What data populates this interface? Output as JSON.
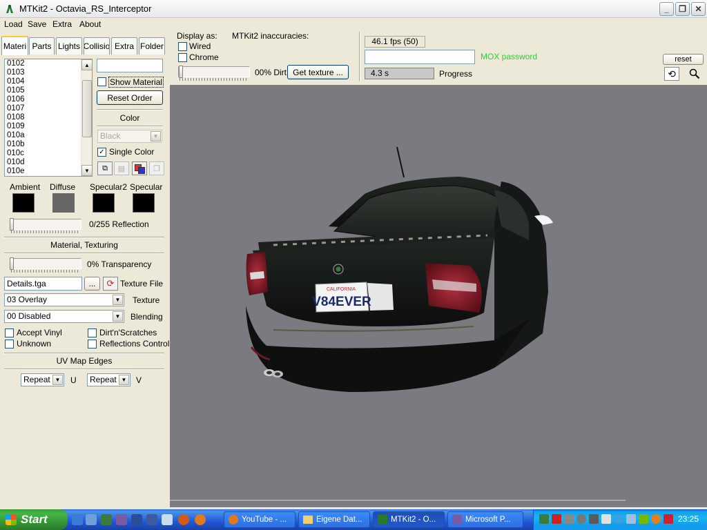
{
  "window": {
    "title": "MTKit2 - Octavia_RS_Interceptor"
  },
  "menu": [
    "Load",
    "Save",
    "Extra",
    "About"
  ],
  "display_as": {
    "label": "Display as:",
    "wired": "Wired",
    "chrome": "Chrome",
    "dirt_label": "00% Dirt",
    "get_texture": "Get texture ..."
  },
  "inaccuracies": {
    "label": "MTKit2 inaccuracies:"
  },
  "status": {
    "fps": "46.1 fps (50)",
    "mox_password": "MOX password",
    "time": "4.3 s",
    "progress_label": "Progress",
    "reset": "reset",
    "progress": 0.0
  },
  "tabs": [
    "Materi",
    "Parts",
    "Lights",
    "Collisio",
    "Extra",
    "Folder"
  ],
  "material_list": [
    "0102",
    "0103",
    "0104",
    "0105",
    "0106",
    "0107",
    "0108",
    "0109",
    "010a",
    "010b",
    "010c",
    "010d",
    "010e"
  ],
  "material_panel": {
    "search_value": "",
    "show_material": "Show Material",
    "reset_order": "Reset Order",
    "color_title": "Color",
    "color_select": "Black",
    "single_color": "Single Color",
    "swatches": [
      {
        "label": "Ambient",
        "color": "#000000"
      },
      {
        "label": "Diffuse",
        "color": "#666666"
      },
      {
        "label": "Specular2",
        "color": "#000000"
      },
      {
        "label": "Specular",
        "color": "#000000"
      }
    ],
    "reflection_label": "0/255 Reflection",
    "texturing_title": "Material, Texturing",
    "transparency_label": "0% Transparency",
    "texture_file_value": "Details.tga",
    "browse_label": "...",
    "texture_file_label": "Texture File",
    "texture_select": "03 Overlay",
    "texture_label": "Texture",
    "blending_select": "00 Disabled",
    "blending_label": "Blending",
    "accept_vinyl": "Accept Vinyl",
    "dirt_scratches": "Dirt'n'Scratches",
    "unknown": "Unknown",
    "reflections_control": "Reflections Control",
    "uv_title": "UV Map Edges",
    "u_select": "Repeat",
    "u_label": "U",
    "v_select": "Repeat",
    "v_label": "V"
  },
  "car": {
    "plate_state": "CALIFORNIA",
    "plate_text": "V84EVER"
  },
  "taskbar": {
    "start": "Start",
    "tasks": [
      "YouTube - ...",
      "Eigene Dat...",
      "MTKit2 - O...",
      "Microsoft P..."
    ],
    "clock": "23:25"
  }
}
